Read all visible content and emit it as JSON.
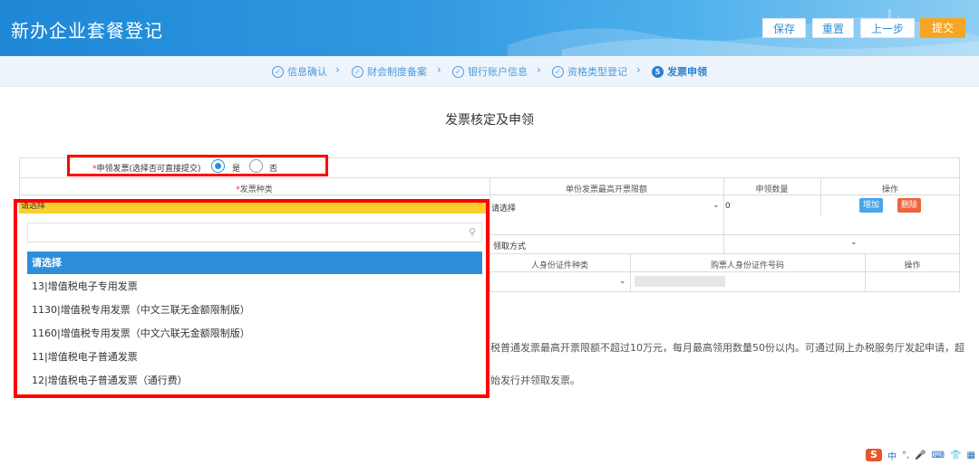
{
  "header": {
    "title": "新办企业套餐登记",
    "buttons": {
      "save": "保存",
      "reset": "重置",
      "prev": "上一步",
      "submit": "提交"
    }
  },
  "steps": [
    {
      "label": "信息确认",
      "status": "done",
      "icon": "check-circle-icon"
    },
    {
      "label": "财会制度备案",
      "status": "done",
      "icon": "check-circle-icon"
    },
    {
      "label": "银行账户信息",
      "status": "done",
      "icon": "check-circle-icon"
    },
    {
      "label": "资格类型登记",
      "status": "done",
      "icon": "check-circle-icon"
    },
    {
      "label": "发票申领",
      "status": "active",
      "number": "5"
    }
  ],
  "section_title": "发票核定及申领",
  "apply": {
    "star": "*",
    "label": "申领发票(选择否可直接提交)",
    "options": [
      "是",
      "否"
    ],
    "selected": "是"
  },
  "table": {
    "headers": {
      "star": "*",
      "invoice_type": "发票种类",
      "max_limit": "单份发票最高开票限额",
      "quantity": "申领数量",
      "action": "操作"
    },
    "row": {
      "invoice_type_value": "请选择",
      "max_limit_value": "请选择",
      "quantity_value": "0",
      "add": "增加",
      "delete": "删除"
    },
    "receive": {
      "label": "领取方式",
      "value": ""
    },
    "buyer": {
      "id_type_header": "人身份证件种类",
      "id_number_header": "购票人身份证件号码",
      "action_header": "操作"
    }
  },
  "dropdown": {
    "search_placeholder": "",
    "options": [
      "请选择",
      "13|增值税电子专用发票",
      "1130|增值税专用发票（中文三联无金额限制版）",
      "1160|增值税专用发票（中文六联无金额限制版）",
      "11|增值税电子普通发票",
      "12|增值税电子普通发票（通行费）"
    ],
    "selected_index": 0
  },
  "notice": {
    "line1": "税普通发票最高开票限额不超过10万元，每月最高领用数量50份以内。可通过网上办税服务厅发起申请，超",
    "line2": "始发行并领取发票。"
  },
  "ime": {
    "logo": "S",
    "mode": "中"
  },
  "colors": {
    "primary": "#2d8fdb",
    "accent_orange": "#f5a623",
    "highlight_red": "#ff0000",
    "select_yellow": "#fbcf2c"
  }
}
